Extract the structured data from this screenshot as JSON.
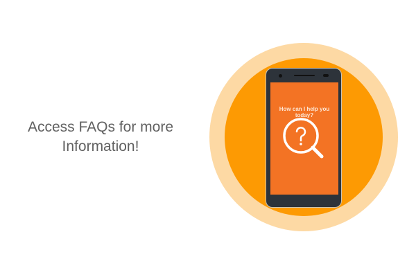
{
  "headline": {
    "line1": "Access FAQs for more",
    "line2": "Information!"
  },
  "phone": {
    "prompt": "How can I help you today?",
    "icon": "magnifier-question-icon"
  },
  "colors": {
    "outer_ring": "#fdd9a4",
    "inner_circle": "#fd9a03",
    "screen": "#f37324",
    "phone_body": "#2d333a",
    "text": "#616161"
  }
}
